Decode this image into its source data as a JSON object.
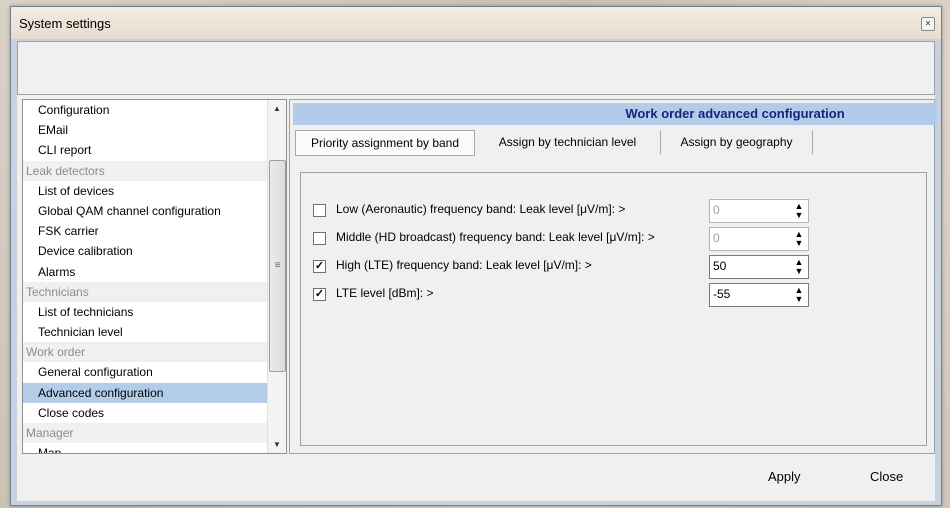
{
  "window": {
    "title": "System settings"
  },
  "nav": {
    "items": [
      {
        "label": "Configuration",
        "type": "item",
        "selected": false
      },
      {
        "label": "EMail",
        "type": "item",
        "selected": false
      },
      {
        "label": "CLI report",
        "type": "item",
        "selected": false
      },
      {
        "label": "Leak detectors",
        "type": "category",
        "selected": false
      },
      {
        "label": "List of devices",
        "type": "item",
        "selected": false
      },
      {
        "label": "Global QAM channel configuration",
        "type": "item",
        "selected": false
      },
      {
        "label": "FSK carrier",
        "type": "item",
        "selected": false
      },
      {
        "label": "Device calibration",
        "type": "item",
        "selected": false
      },
      {
        "label": "Alarms",
        "type": "item",
        "selected": false
      },
      {
        "label": "Technicians",
        "type": "category",
        "selected": false
      },
      {
        "label": "List of technicians",
        "type": "item",
        "selected": false
      },
      {
        "label": "Technician level",
        "type": "item",
        "selected": false
      },
      {
        "label": "Work order",
        "type": "category",
        "selected": false
      },
      {
        "label": "General configuration",
        "type": "item",
        "selected": false
      },
      {
        "label": "Advanced configuration",
        "type": "item",
        "selected": true
      },
      {
        "label": "Close codes",
        "type": "item",
        "selected": false
      },
      {
        "label": "Manager",
        "type": "category",
        "selected": false
      },
      {
        "label": "Map",
        "type": "item",
        "selected": false
      }
    ]
  },
  "panel": {
    "title": "Work order advanced configuration",
    "tabs": [
      {
        "label": "Priority assignment by band",
        "active": true
      },
      {
        "label": "Assign by technician level",
        "active": false
      },
      {
        "label": "Assign by geography",
        "active": false
      }
    ],
    "rows": [
      {
        "label": "Low (Aeronautic) frequency band: Leak level [μV/m]: >",
        "checked": false,
        "value": "0"
      },
      {
        "label": "Middle (HD broadcast) frequency band: Leak level [μV/m]: >",
        "checked": false,
        "value": "0"
      },
      {
        "label": "High (LTE) frequency band: Leak level [μV/m]: >",
        "checked": true,
        "value": "50"
      },
      {
        "label": "LTE level [dBm]: >",
        "checked": true,
        "value": "-55"
      }
    ]
  },
  "footer": {
    "apply": "Apply",
    "close": "Close"
  },
  "colors": {
    "selection": "#b3cde9",
    "header_bg": "#b3cbea",
    "header_text": "#10287a"
  }
}
